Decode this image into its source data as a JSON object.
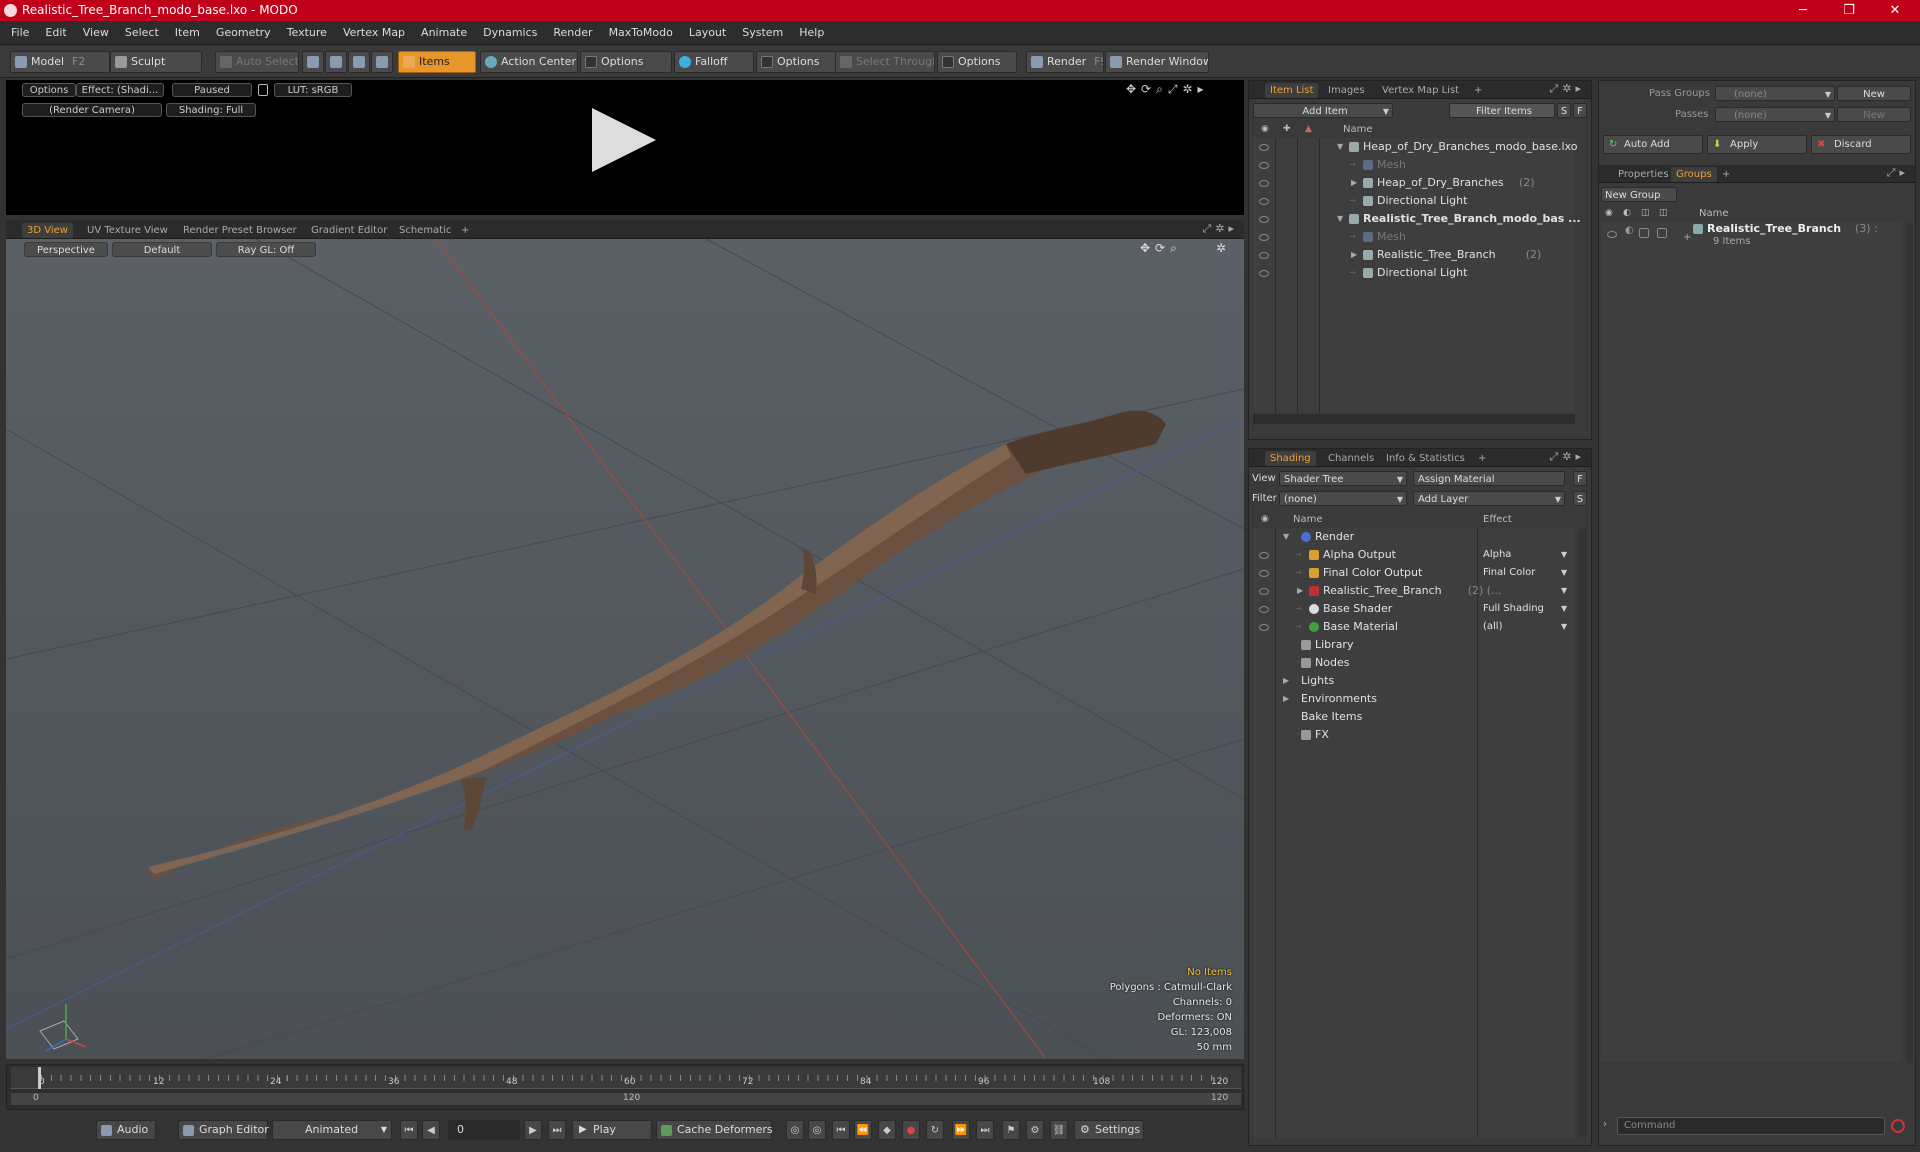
{
  "window": {
    "title": "Realistic_Tree_Branch_modo_base.lxo - MODO",
    "minimize": "─",
    "maximize": "❐",
    "close": "✕"
  },
  "menu": [
    "File",
    "Edit",
    "View",
    "Select",
    "Item",
    "Geometry",
    "Texture",
    "Vertex Map",
    "Animate",
    "Dynamics",
    "Render",
    "MaxToModo",
    "Layout",
    "System",
    "Help"
  ],
  "toolbar": {
    "model": "Model",
    "model_key": "F2",
    "sculpt": "Sculpt",
    "auto_select": "Auto Select",
    "items": "Items",
    "action_center": "Action Center",
    "options1": "Options",
    "falloff": "Falloff",
    "options2": "Options",
    "select_through": "Select Through",
    "options3": "Options",
    "render": "Render",
    "render_key": "F9",
    "render_window": "Render Window"
  },
  "preview": {
    "options": "Options",
    "effect": "Effect: (Shadi...",
    "paused": "Paused",
    "lut": "LUT: sRGB",
    "camera": "(Render Camera)",
    "shading": "Shading: Full"
  },
  "viewport_tabs": [
    "3D View",
    "UV Texture View",
    "Render Preset Browser",
    "Gradient Editor",
    "Schematic",
    "+"
  ],
  "viewport": {
    "perspective": "Perspective",
    "default": "Default",
    "raygl": "Ray GL: Off",
    "hud": {
      "no_items": "No Items",
      "polygons": "Polygons : Catmull-Clark",
      "channels": "Channels: 0",
      "deformers": "Deformers: ON",
      "gl": "GL: 123,008",
      "mm": "50 mm"
    }
  },
  "timeline": {
    "ticks": [
      "0",
      "12",
      "24",
      "36",
      "48",
      "60",
      "72",
      "84",
      "96",
      "108",
      "120"
    ],
    "sub_ticks": [
      "0",
      "120",
      "120"
    ]
  },
  "bottom": {
    "audio": "Audio",
    "graph_editor": "Graph Editor",
    "animated": "Animated",
    "frame": "0",
    "play": "Play",
    "cache_deformers": "Cache Deformers",
    "settings": "Settings"
  },
  "item_list": {
    "tabs": [
      "Item List",
      "Images",
      "Vertex Map List",
      "+"
    ],
    "add_item": "Add Item",
    "filter": "Filter Items",
    "s": "S",
    "f": "F",
    "col_name": "Name",
    "rows": [
      {
        "label": "Heap_of_Dry_Branches_modo_base.lxo",
        "count": "",
        "indent": 0,
        "bold": false,
        "dim": false,
        "arrow": "▼"
      },
      {
        "label": "Mesh",
        "count": "",
        "indent": 1,
        "bold": false,
        "dim": true,
        "arrow": ""
      },
      {
        "label": "Heap_of_Dry_Branches",
        "count": "(2)",
        "indent": 1,
        "bold": false,
        "dim": false,
        "arrow": "▶"
      },
      {
        "label": "Directional Light",
        "count": "",
        "indent": 1,
        "bold": false,
        "dim": false,
        "arrow": ""
      },
      {
        "label": "Realistic_Tree_Branch_modo_bas ...",
        "count": "",
        "indent": 0,
        "bold": true,
        "dim": false,
        "arrow": "▼"
      },
      {
        "label": "Mesh",
        "count": "",
        "indent": 1,
        "bold": false,
        "dim": true,
        "arrow": ""
      },
      {
        "label": "Realistic_Tree_Branch",
        "count": "(2)",
        "indent": 1,
        "bold": false,
        "dim": false,
        "arrow": "▶"
      },
      {
        "label": "Directional Light",
        "count": "",
        "indent": 1,
        "bold": false,
        "dim": false,
        "arrow": ""
      }
    ]
  },
  "shading": {
    "tabs": [
      "Shading",
      "Channels",
      "Info & Statistics",
      "+"
    ],
    "view_label": "View",
    "view_value": "Shader Tree",
    "assign_material": "Assign Material",
    "f": "F",
    "filter_label": "Filter",
    "filter_value": "(none)",
    "add_layer": "Add Layer",
    "s": "S",
    "col_name": "Name",
    "col_effect": "Effect",
    "rows": [
      {
        "label": "Render",
        "count": "",
        "effect": "",
        "indent": 0,
        "arrow": "▼",
        "icon": "#4a6fd0"
      },
      {
        "label": "Alpha Output",
        "count": "",
        "effect": "Alpha",
        "indent": 1,
        "arrow": "",
        "icon": "#d8a030"
      },
      {
        "label": "Final Color Output",
        "count": "",
        "effect": "Final Color",
        "indent": 1,
        "arrow": "",
        "icon": "#d8a030"
      },
      {
        "label": "Realistic_Tree_Branch",
        "count": "(2) (...",
        "effect": "",
        "indent": 1,
        "arrow": "▶",
        "icon": "#c03030"
      },
      {
        "label": "Base Shader",
        "count": "",
        "effect": "Full Shading",
        "indent": 1,
        "arrow": "",
        "icon": "#dddddd"
      },
      {
        "label": "Base Material",
        "count": "",
        "effect": "(all)",
        "indent": 1,
        "arrow": "",
        "icon": "#40a040"
      },
      {
        "label": "Library",
        "count": "",
        "effect": "",
        "indent": 0,
        "arrow": "",
        "icon": "#999999"
      },
      {
        "label": "Nodes",
        "count": "",
        "effect": "",
        "indent": 0,
        "arrow": "",
        "icon": "#999999"
      },
      {
        "label": "Lights",
        "count": "",
        "effect": "",
        "indent": -1,
        "arrow": "▶",
        "icon": ""
      },
      {
        "label": "Environments",
        "count": "",
        "effect": "",
        "indent": -1,
        "arrow": "▶",
        "icon": ""
      },
      {
        "label": "Bake Items",
        "count": "",
        "effect": "",
        "indent": -1,
        "arrow": "",
        "icon": ""
      },
      {
        "label": "FX",
        "count": "",
        "effect": "",
        "indent": 0,
        "arrow": "",
        "icon": "#999999"
      }
    ]
  },
  "groups": {
    "pass_groups_label": "Pass Groups",
    "pass_groups_value": "(none)",
    "new": "New",
    "passes_label": "Passes",
    "passes_value": "(none)",
    "new2": "New",
    "auto_add": "Auto Add",
    "apply": "Apply",
    "discard": "Discard",
    "tabs": [
      "Properties",
      "Groups",
      "+"
    ],
    "new_group": "New Group",
    "col_name": "Name",
    "group_name": "Realistic_Tree_Branch",
    "group_count": "(3) :",
    "group_items": "9 Items"
  },
  "command": {
    "placeholder": "Command"
  }
}
